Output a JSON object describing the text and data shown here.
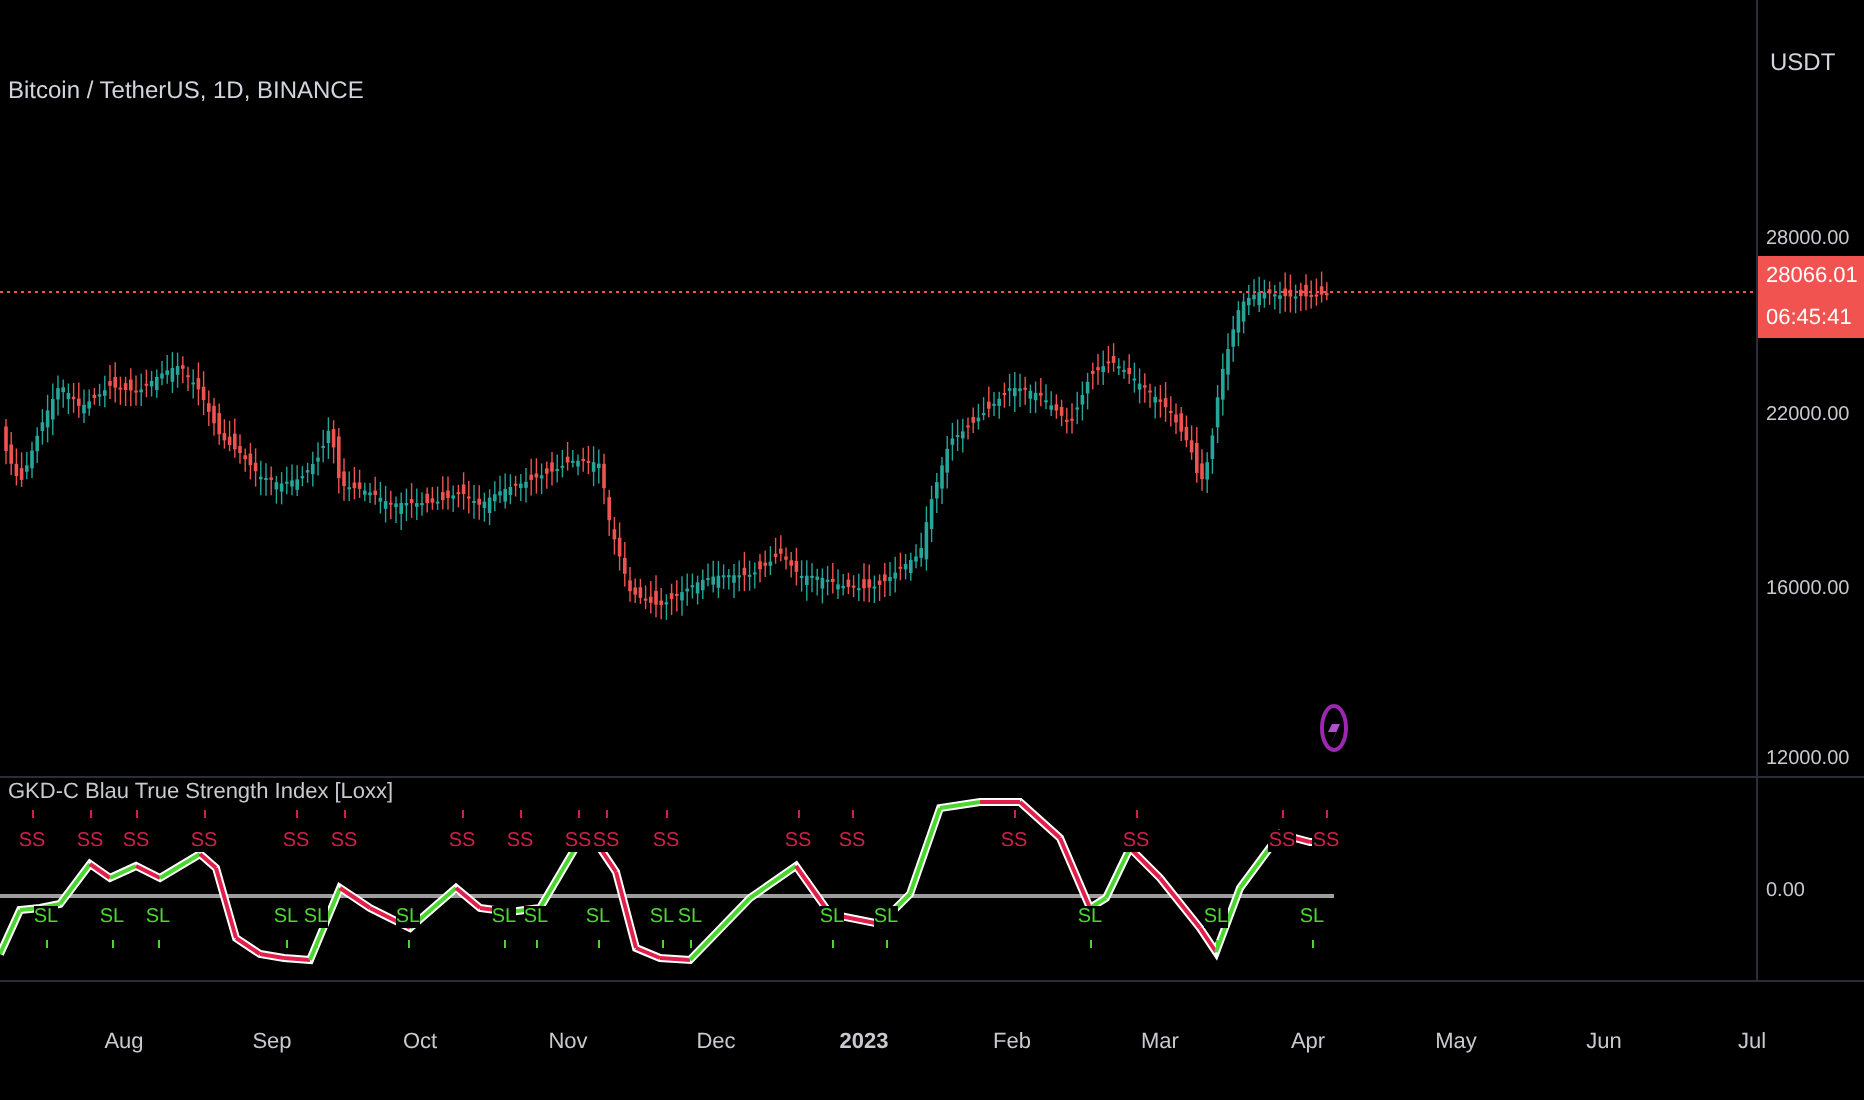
{
  "symbol_title": "Bitcoin / TetherUS, 1D, BINANCE",
  "price_axis": {
    "currency": "USDT",
    "labels": [
      "28000.00",
      "22000.00",
      "16000.00",
      "12000.00"
    ],
    "last_price": "28066.01",
    "countdown": "06:45:41"
  },
  "indicator": {
    "title": "GKD-C Blau True Strength Index [Loxx]",
    "axis_label": "0.00",
    "signals": [
      {
        "kind": "short",
        "text": "SS"
      },
      {
        "kind": "short",
        "text": "SS"
      },
      {
        "kind": "short",
        "text": "SS"
      },
      {
        "kind": "short",
        "text": "SS"
      },
      {
        "kind": "short",
        "text": "SS"
      },
      {
        "kind": "short",
        "text": "SS"
      },
      {
        "kind": "short",
        "text": "SS"
      },
      {
        "kind": "short",
        "text": "SS"
      },
      {
        "kind": "short",
        "text": "SS"
      },
      {
        "kind": "short",
        "text": "SS"
      },
      {
        "kind": "short",
        "text": "SS"
      },
      {
        "kind": "short",
        "text": "SS"
      },
      {
        "kind": "short",
        "text": "SS"
      },
      {
        "kind": "short",
        "text": "SS"
      },
      {
        "kind": "short",
        "text": "SS"
      },
      {
        "kind": "short",
        "text": "SS"
      },
      {
        "kind": "short",
        "text": "SS"
      },
      {
        "kind": "long",
        "text": "SL"
      },
      {
        "kind": "long",
        "text": "SL"
      },
      {
        "kind": "long",
        "text": "SL"
      },
      {
        "kind": "long",
        "text": "SL"
      },
      {
        "kind": "long",
        "text": "SL"
      },
      {
        "kind": "long",
        "text": "SL"
      },
      {
        "kind": "long",
        "text": "SL"
      },
      {
        "kind": "long",
        "text": "SL"
      },
      {
        "kind": "long",
        "text": "SL"
      },
      {
        "kind": "long",
        "text": "SL"
      },
      {
        "kind": "long",
        "text": "SL"
      },
      {
        "kind": "long",
        "text": "SL"
      },
      {
        "kind": "long",
        "text": "SL"
      },
      {
        "kind": "long",
        "text": "SL"
      },
      {
        "kind": "long",
        "text": "SL"
      },
      {
        "kind": "long",
        "text": "SL"
      }
    ]
  },
  "time_axis": [
    {
      "kind": "month",
      "text": "Aug"
    },
    {
      "kind": "month",
      "text": "Sep"
    },
    {
      "kind": "month",
      "text": "Oct"
    },
    {
      "kind": "month",
      "text": "Nov"
    },
    {
      "kind": "month",
      "text": "Dec"
    },
    {
      "kind": "year",
      "text": "2023"
    },
    {
      "kind": "month",
      "text": "Feb"
    },
    {
      "kind": "month",
      "text": "Mar"
    },
    {
      "kind": "month",
      "text": "Apr"
    },
    {
      "kind": "month",
      "text": "May"
    },
    {
      "kind": "month",
      "text": "Jun"
    },
    {
      "kind": "month",
      "text": "Jul"
    }
  ]
}
